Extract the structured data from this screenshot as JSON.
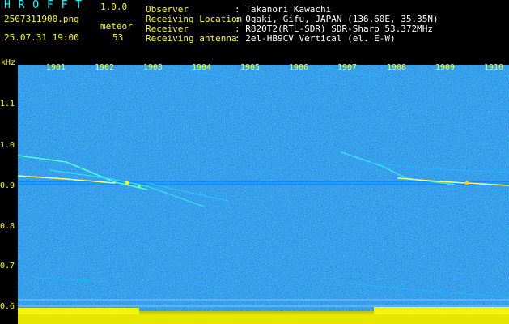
{
  "header": {
    "title": "H R O F F T",
    "version": "1.0.0",
    "filename": "2507311900.png",
    "datetime": "25.07.31 19:00",
    "meteor_label": "meteor",
    "meteor_count": "53",
    "fields": [
      {
        "label": "Observer",
        "value": ": Takanori Kawachi"
      },
      {
        "label": "Receiving Location",
        "value": ": Ogaki, Gifu, JAPAN (136.60E, 35.35N)"
      },
      {
        "label": "Receiver",
        "value": ": R820T2(RTL-SDR) SDR-Sharp 53.372MHz"
      },
      {
        "label": "Receiving antenna",
        "value": ": 2el-HB9CV Vertical (el. E-W)"
      }
    ]
  },
  "axes": {
    "y_unit": "kHz",
    "y_ticks": [
      "1.1",
      "1.0",
      "0.9",
      "0.8",
      "0.7",
      "0.6"
    ],
    "x_ticks": [
      "1901",
      "1902",
      "1903",
      "1904",
      "1905",
      "1906",
      "1907",
      "1908",
      "1909",
      "1910"
    ]
  },
  "colors": {
    "background": "#000000",
    "header_yellow": "#ffff00",
    "header_white": "#ffffff",
    "noise_blue": "#0a0a8c",
    "signal_cyan": "#00ffff",
    "signal_yellow": "#ffff00"
  }
}
